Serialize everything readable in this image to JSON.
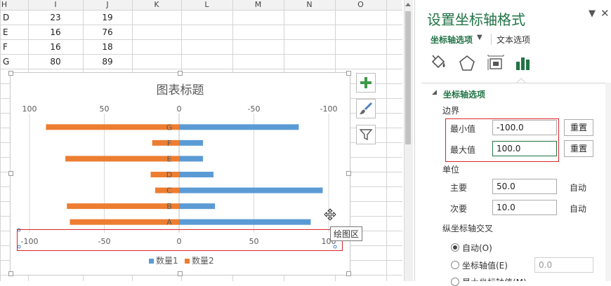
{
  "sheet": {
    "columns": [
      "H",
      "I",
      "J",
      "K",
      "L",
      "M",
      "N",
      "O"
    ],
    "rows": [
      {
        "label": "D",
        "i": "23",
        "j": "19"
      },
      {
        "label": "E",
        "i": "16",
        "j": "76"
      },
      {
        "label": "F",
        "i": "16",
        "j": "18"
      },
      {
        "label": "G",
        "i": "80",
        "j": "89"
      }
    ]
  },
  "chart": {
    "title": "图表标题",
    "tooltip": "绘图区",
    "top_axis_ticks": [
      "100",
      "50",
      "0",
      "-50",
      "-100"
    ],
    "bottom_axis_ticks": [
      "-100",
      "-50",
      "0",
      "50",
      "100"
    ],
    "legend": [
      {
        "name": "数量1",
        "color": "#5b9bd5"
      },
      {
        "name": "数量2",
        "color": "#ed7d31"
      }
    ]
  },
  "chart_data": {
    "type": "bar",
    "orientation": "horizontal",
    "title": "图表标题",
    "categories": [
      "A",
      "B",
      "C",
      "D",
      "E",
      "F",
      "G"
    ],
    "series": [
      {
        "name": "数量1",
        "values": [
          88,
          24,
          96,
          23,
          16,
          16,
          80
        ],
        "color": "#5b9bd5"
      },
      {
        "name": "数量2",
        "values": [
          73,
          75,
          16,
          19,
          76,
          18,
          89
        ],
        "color": "#ed7d31"
      }
    ],
    "xlim": [
      -100,
      100
    ],
    "grid": true,
    "legend_position": "bottom"
  },
  "pane": {
    "title": "设置坐标轴格式",
    "tab_axis_options": "坐标轴选项",
    "tab_text_options": "文本选项",
    "section_title": "坐标轴选项",
    "bounds_label": "边界",
    "min_label": "最小值",
    "min_value": "-100.0",
    "max_label": "最大值",
    "max_value": "100.0",
    "reset_label": "重置",
    "units_label": "单位",
    "major_label": "主要",
    "major_value": "50.0",
    "minor_label": "次要",
    "minor_value": "10.0",
    "auto_label": "自动",
    "cross_label": "纵坐标轴交叉",
    "radio_auto": "自动(O)",
    "radio_axis_value": "坐标轴值(E)",
    "axis_value": "0.0",
    "radio_max": "最大坐标轴值(M)",
    "icons": [
      "fill-line-icon",
      "effects-icon",
      "size-properties-icon",
      "axis-options-icon"
    ]
  }
}
